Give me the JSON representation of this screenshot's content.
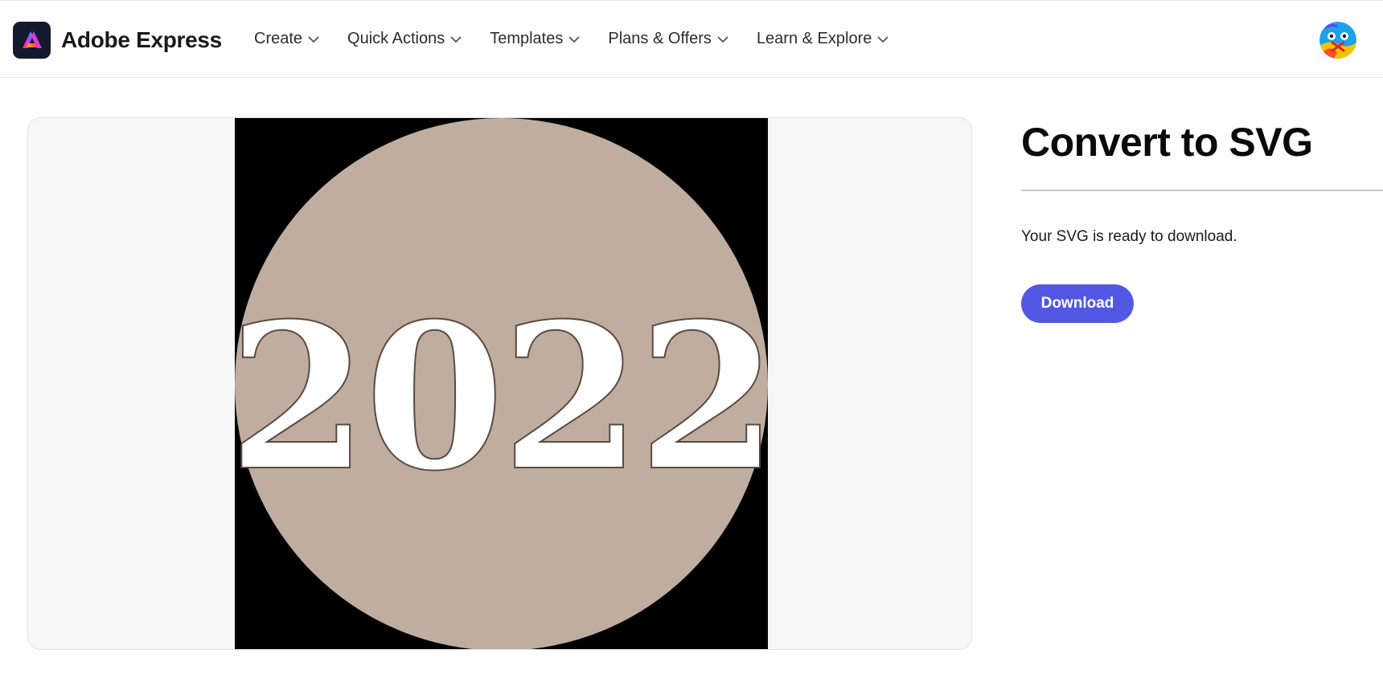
{
  "header": {
    "brand": "Adobe Express",
    "nav": [
      {
        "label": "Create"
      },
      {
        "label": "Quick Actions"
      },
      {
        "label": "Templates"
      },
      {
        "label": "Plans & Offers"
      },
      {
        "label": "Learn & Explore"
      }
    ]
  },
  "preview": {
    "image_text": "2022",
    "circle_color": "#bfada0",
    "background_color": "#000000"
  },
  "panel": {
    "title": "Convert to SVG",
    "status": "Your SVG is ready to download.",
    "download_label": "Download"
  },
  "colors": {
    "accent": "#5258e4"
  }
}
